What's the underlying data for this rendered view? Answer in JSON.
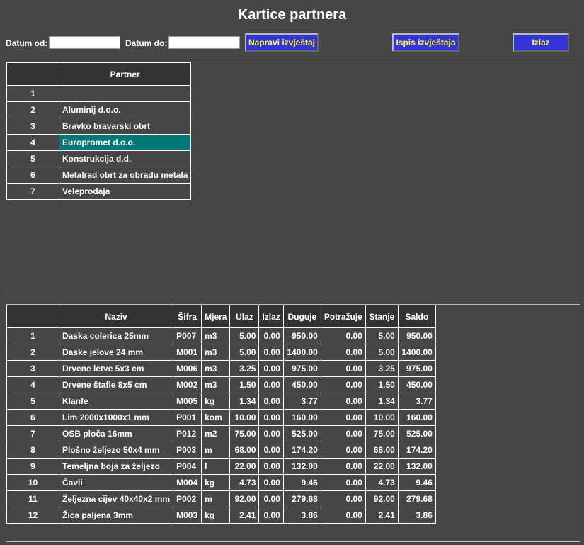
{
  "window": {
    "title": "Kartice partnera"
  },
  "toolbar": {
    "date_from_label": "Datum od:",
    "date_from_value": "",
    "date_to_label": "Datum do:",
    "date_to_value": "",
    "make_report_label": "Napravi izvještaj",
    "print_report_label": "Ispis izvještaja",
    "exit_label": "Izlaz"
  },
  "partners": {
    "header": "Partner",
    "selected_index": 3,
    "rows": [
      {
        "n": "1",
        "name": ""
      },
      {
        "n": "2",
        "name": "Aluminij d.o.o."
      },
      {
        "n": "3",
        "name": "Bravko bravarski obrt"
      },
      {
        "n": "4",
        "name": "Europromet d.o.o."
      },
      {
        "n": "5",
        "name": "Konstrukcija d.d."
      },
      {
        "n": "6",
        "name": "Metalrad obrt za obradu metala"
      },
      {
        "n": "7",
        "name": "Veleprodaja"
      }
    ]
  },
  "items": {
    "headers": [
      "Naziv",
      "Šifra",
      "Mjera",
      "Ulaz",
      "Izlaz",
      "Duguje",
      "Potražuje",
      "Stanje",
      "Saldo"
    ],
    "rows": [
      [
        "1",
        "Daska colerica 25mm",
        "P007",
        "m3",
        "5.00",
        "0.00",
        "950.00",
        "0.00",
        "5.00",
        "950.00"
      ],
      [
        "2",
        "Daske jelove 24 mm",
        "M001",
        "m3",
        "5.00",
        "0.00",
        "1400.00",
        "0.00",
        "5.00",
        "1400.00"
      ],
      [
        "3",
        "Drvene letve 5x3 cm",
        "M006",
        "m3",
        "3.25",
        "0.00",
        "975.00",
        "0.00",
        "3.25",
        "975.00"
      ],
      [
        "4",
        "Drvene štafle 8x5 cm",
        "M002",
        "m3",
        "1.50",
        "0.00",
        "450.00",
        "0.00",
        "1.50",
        "450.00"
      ],
      [
        "5",
        "Klanfe",
        "M005",
        "kg",
        "1.34",
        "0.00",
        "3.77",
        "0.00",
        "1.34",
        "3.77"
      ],
      [
        "6",
        "Lim 2000x1000x1 mm",
        "P001",
        "kom",
        "10.00",
        "0.00",
        "160.00",
        "0.00",
        "10.00",
        "160.00"
      ],
      [
        "7",
        "OSB ploča 16mm",
        "P012",
        "m2",
        "75.00",
        "0.00",
        "525.00",
        "0.00",
        "75.00",
        "525.00"
      ],
      [
        "8",
        "Plošno željezo 50x4 mm",
        "P003",
        "m",
        "68.00",
        "0.00",
        "174.20",
        "0.00",
        "68.00",
        "174.20"
      ],
      [
        "9",
        "Temeljna boja za željezo",
        "P004",
        "l",
        "22.00",
        "0.00",
        "132.00",
        "0.00",
        "22.00",
        "132.00"
      ],
      [
        "10",
        "Čavli",
        "M004",
        "kg",
        "4.73",
        "0.00",
        "9.46",
        "0.00",
        "4.73",
        "9.46"
      ],
      [
        "11",
        "Željezna cijev 40x40x2 mm",
        "P002",
        "m",
        "92.00",
        "0.00",
        "279.68",
        "0.00",
        "92.00",
        "279.68"
      ],
      [
        "12",
        "Žica paljena 3mm",
        "M003",
        "kg",
        "2.41",
        "0.00",
        "3.86",
        "0.00",
        "2.41",
        "3.86"
      ]
    ]
  },
  "colors": {
    "background": "#464646",
    "header": "#333333",
    "selected": "#007878",
    "button_bg": "#3434d8",
    "button_text": "#ffff33"
  }
}
